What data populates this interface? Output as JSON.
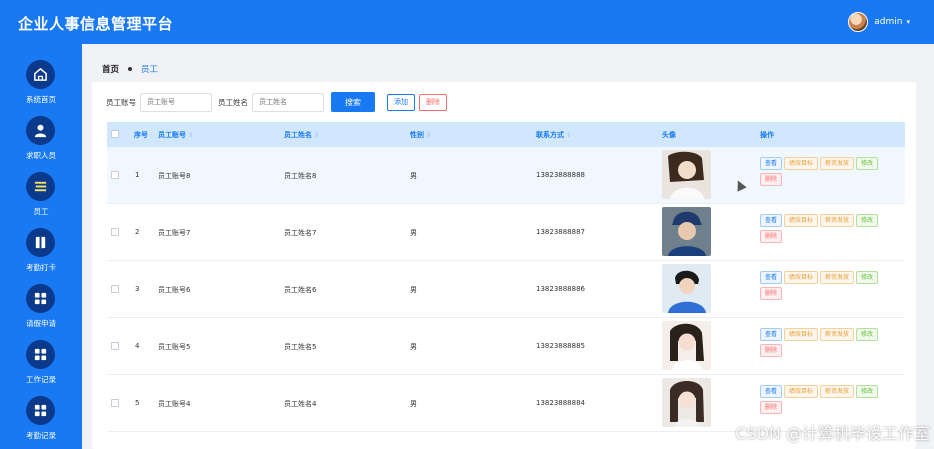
{
  "app": {
    "title": "企业人事信息管理平台",
    "user": "admin"
  },
  "sidebar": {
    "items": [
      {
        "label": "系统首页",
        "icon": "home-icon"
      },
      {
        "label": "求职人员",
        "icon": "user-icon"
      },
      {
        "label": "员工",
        "icon": "list-icon"
      },
      {
        "label": "考勤打卡",
        "icon": "book-icon"
      },
      {
        "label": "请假申请",
        "icon": "grid-icon"
      },
      {
        "label": "工作记录",
        "icon": "grid-icon"
      },
      {
        "label": "考勤记录",
        "icon": "grid-icon"
      }
    ]
  },
  "breadcrumb": {
    "home": "首页",
    "current": "员工"
  },
  "search": {
    "account_label": "员工账号",
    "account_placeholder": "员工账号",
    "name_label": "员工姓名",
    "name_placeholder": "员工姓名",
    "search_button": "搜索",
    "add_button": "添加",
    "delete_button": "删除"
  },
  "table": {
    "headers": {
      "index": "序号",
      "account": "员工账号",
      "name": "员工姓名",
      "gender": "性别",
      "phone": "联系方式",
      "avatar": "头像",
      "actions": "操作"
    },
    "actions": {
      "view": "查看",
      "goal": "绩效目标",
      "salary": "薪资发放",
      "edit": "修改",
      "delete": "删除"
    },
    "rows": [
      {
        "index": "1",
        "account": "员工账号8",
        "name": "员工姓名8",
        "gender": "男",
        "phone": "13823888888"
      },
      {
        "index": "2",
        "account": "员工账号7",
        "name": "员工姓名7",
        "gender": "男",
        "phone": "13823888887"
      },
      {
        "index": "3",
        "account": "员工账号6",
        "name": "员工姓名6",
        "gender": "男",
        "phone": "13823888886"
      },
      {
        "index": "4",
        "account": "员工账号5",
        "name": "员工姓名5",
        "gender": "男",
        "phone": "13823888885"
      },
      {
        "index": "5",
        "account": "员工账号4",
        "name": "员工姓名4",
        "gender": "男",
        "phone": "13823888884"
      }
    ]
  },
  "watermark": "CSDN @计算机毕设工作室",
  "colors": {
    "primary": "#1879f2",
    "nav_circle": "#0b3a8c",
    "danger": "#f56c6c",
    "warning": "#e6a23c",
    "success": "#67c23a"
  }
}
